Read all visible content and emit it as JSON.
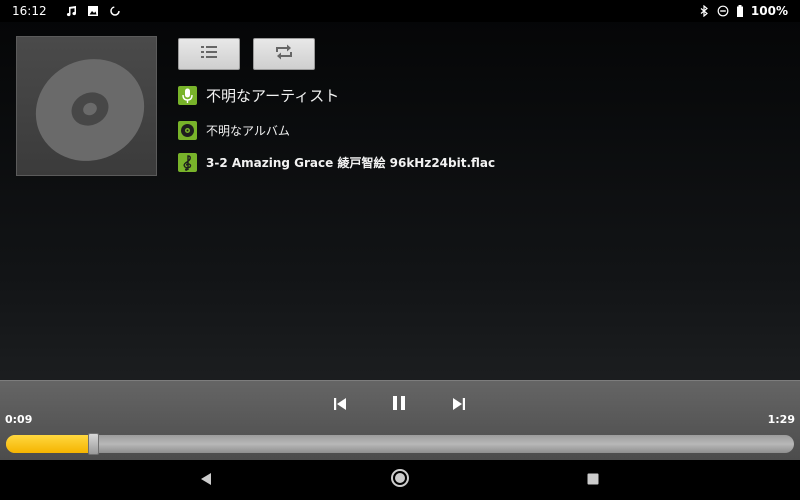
{
  "status_bar": {
    "time": "16:12",
    "battery": "100%",
    "left_icons": [
      "music-note-icon",
      "image-icon",
      "sync-icon"
    ],
    "right_icons": [
      "bluetooth-icon",
      "do-not-disturb-icon",
      "battery-icon"
    ]
  },
  "track": {
    "artist": "不明なアーティスト",
    "album": "不明なアルバム",
    "file": "3-2 Amazing Grace 綾戸智絵 96kHz24bit.flac"
  },
  "buttons": {
    "playlist_icon": "playlist-icon",
    "repeat_icon": "repeat-icon"
  },
  "player": {
    "elapsed": "0:09",
    "total": "1:29",
    "progress_fraction": 0.11,
    "state": "playing",
    "controls": [
      "previous-icon",
      "pause-icon",
      "next-icon"
    ]
  },
  "navbar": {
    "buttons": [
      "back-icon",
      "home-icon",
      "recents-icon"
    ]
  },
  "colors": {
    "accent_green": "#78b32a",
    "seek_fill": "#f5b400"
  }
}
